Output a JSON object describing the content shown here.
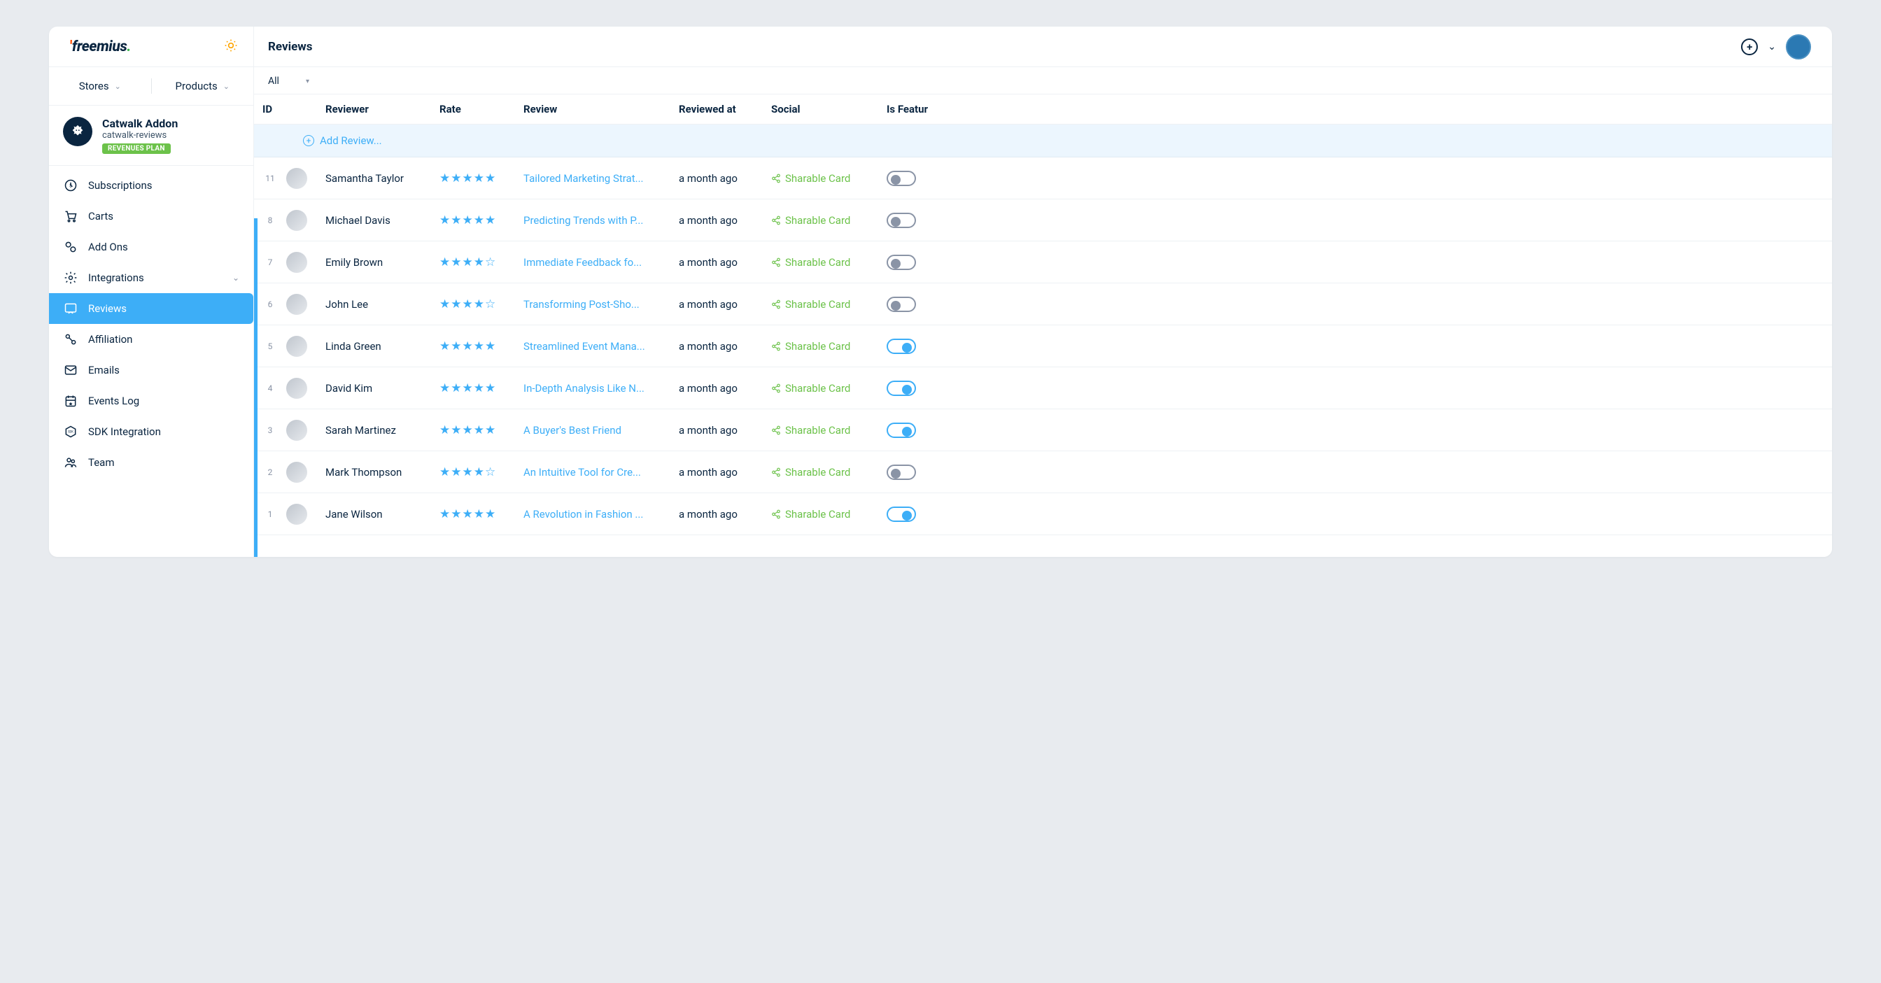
{
  "header": {
    "logo_text": "freemius",
    "page_title": "Reviews"
  },
  "sidebar": {
    "tabs": {
      "stores": "Stores",
      "products": "Products"
    },
    "product": {
      "name": "Catwalk Addon",
      "slug": "catwalk-reviews",
      "badge": "REVENUES PLAN"
    },
    "nav": [
      {
        "label": "Subscriptions",
        "icon": "subscriptions"
      },
      {
        "label": "Carts",
        "icon": "cart"
      },
      {
        "label": "Add Ons",
        "icon": "addons"
      },
      {
        "label": "Integrations",
        "icon": "integrations",
        "expandable": true
      },
      {
        "label": "Reviews",
        "icon": "reviews",
        "active": true
      },
      {
        "label": "Affiliation",
        "icon": "affiliation"
      },
      {
        "label": "Emails",
        "icon": "emails"
      },
      {
        "label": "Events Log",
        "icon": "events"
      },
      {
        "label": "SDK Integration",
        "icon": "sdk"
      },
      {
        "label": "Team",
        "icon": "team"
      }
    ]
  },
  "toolbar": {
    "filter": "All"
  },
  "columns": {
    "id": "ID",
    "reviewer": "Reviewer",
    "rate": "Rate",
    "review": "Review",
    "reviewed_at": "Reviewed at",
    "social": "Social",
    "is_featured": "Is Featur"
  },
  "add_review_label": "Add Review...",
  "sharable_card_label": "Sharable Card",
  "rows": [
    {
      "id": "11",
      "name": "Samantha Taylor",
      "stars": 5,
      "review": "Tailored Marketing Strat...",
      "date": "a month ago",
      "featured": false
    },
    {
      "id": "8",
      "name": "Michael Davis",
      "stars": 5,
      "review": "Predicting Trends with P...",
      "date": "a month ago",
      "featured": false
    },
    {
      "id": "7",
      "name": "Emily Brown",
      "stars": 4,
      "review": "Immediate Feedback fo...",
      "date": "a month ago",
      "featured": false
    },
    {
      "id": "6",
      "name": "John Lee",
      "stars": 4,
      "review": "Transforming Post-Sho...",
      "date": "a month ago",
      "featured": false
    },
    {
      "id": "5",
      "name": "Linda Green",
      "stars": 5,
      "review": "Streamlined Event Mana...",
      "date": "a month ago",
      "featured": true
    },
    {
      "id": "4",
      "name": "David Kim",
      "stars": 5,
      "review": "In-Depth Analysis Like N...",
      "date": "a month ago",
      "featured": true
    },
    {
      "id": "3",
      "name": "Sarah Martinez",
      "stars": 5,
      "review": "A Buyer's Best Friend",
      "date": "a month ago",
      "featured": true
    },
    {
      "id": "2",
      "name": "Mark Thompson",
      "stars": 4,
      "review": "An Intuitive Tool for Cre...",
      "date": "a month ago",
      "featured": false
    },
    {
      "id": "1",
      "name": "Jane Wilson",
      "stars": 5,
      "review": "A Revolution in Fashion ...",
      "date": "a month ago",
      "featured": true
    }
  ]
}
